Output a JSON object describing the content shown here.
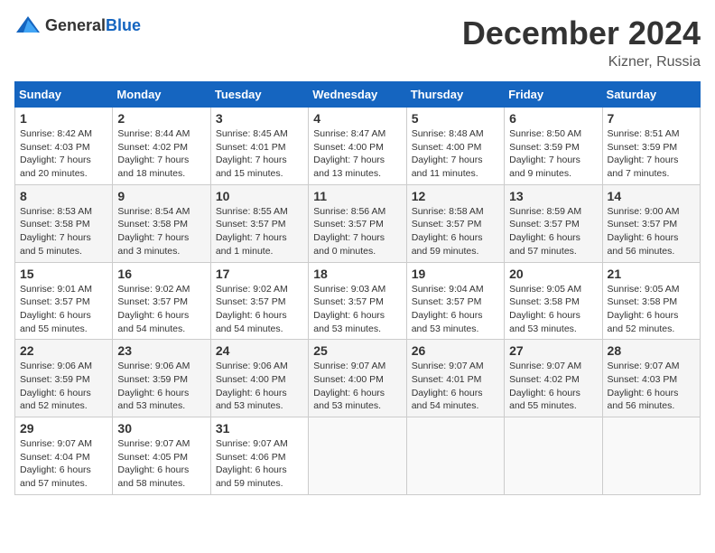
{
  "header": {
    "logo_general": "General",
    "logo_blue": "Blue",
    "title": "December 2024",
    "location": "Kizner, Russia"
  },
  "weekdays": [
    "Sunday",
    "Monday",
    "Tuesday",
    "Wednesday",
    "Thursday",
    "Friday",
    "Saturday"
  ],
  "weeks": [
    [
      {
        "day": "1",
        "info": "Sunrise: 8:42 AM\nSunset: 4:03 PM\nDaylight: 7 hours\nand 20 minutes."
      },
      {
        "day": "2",
        "info": "Sunrise: 8:44 AM\nSunset: 4:02 PM\nDaylight: 7 hours\nand 18 minutes."
      },
      {
        "day": "3",
        "info": "Sunrise: 8:45 AM\nSunset: 4:01 PM\nDaylight: 7 hours\nand 15 minutes."
      },
      {
        "day": "4",
        "info": "Sunrise: 8:47 AM\nSunset: 4:00 PM\nDaylight: 7 hours\nand 13 minutes."
      },
      {
        "day": "5",
        "info": "Sunrise: 8:48 AM\nSunset: 4:00 PM\nDaylight: 7 hours\nand 11 minutes."
      },
      {
        "day": "6",
        "info": "Sunrise: 8:50 AM\nSunset: 3:59 PM\nDaylight: 7 hours\nand 9 minutes."
      },
      {
        "day": "7",
        "info": "Sunrise: 8:51 AM\nSunset: 3:59 PM\nDaylight: 7 hours\nand 7 minutes."
      }
    ],
    [
      {
        "day": "8",
        "info": "Sunrise: 8:53 AM\nSunset: 3:58 PM\nDaylight: 7 hours\nand 5 minutes."
      },
      {
        "day": "9",
        "info": "Sunrise: 8:54 AM\nSunset: 3:58 PM\nDaylight: 7 hours\nand 3 minutes."
      },
      {
        "day": "10",
        "info": "Sunrise: 8:55 AM\nSunset: 3:57 PM\nDaylight: 7 hours\nand 1 minute."
      },
      {
        "day": "11",
        "info": "Sunrise: 8:56 AM\nSunset: 3:57 PM\nDaylight: 7 hours\nand 0 minutes."
      },
      {
        "day": "12",
        "info": "Sunrise: 8:58 AM\nSunset: 3:57 PM\nDaylight: 6 hours\nand 59 minutes."
      },
      {
        "day": "13",
        "info": "Sunrise: 8:59 AM\nSunset: 3:57 PM\nDaylight: 6 hours\nand 57 minutes."
      },
      {
        "day": "14",
        "info": "Sunrise: 9:00 AM\nSunset: 3:57 PM\nDaylight: 6 hours\nand 56 minutes."
      }
    ],
    [
      {
        "day": "15",
        "info": "Sunrise: 9:01 AM\nSunset: 3:57 PM\nDaylight: 6 hours\nand 55 minutes."
      },
      {
        "day": "16",
        "info": "Sunrise: 9:02 AM\nSunset: 3:57 PM\nDaylight: 6 hours\nand 54 minutes."
      },
      {
        "day": "17",
        "info": "Sunrise: 9:02 AM\nSunset: 3:57 PM\nDaylight: 6 hours\nand 54 minutes."
      },
      {
        "day": "18",
        "info": "Sunrise: 9:03 AM\nSunset: 3:57 PM\nDaylight: 6 hours\nand 53 minutes."
      },
      {
        "day": "19",
        "info": "Sunrise: 9:04 AM\nSunset: 3:57 PM\nDaylight: 6 hours\nand 53 minutes."
      },
      {
        "day": "20",
        "info": "Sunrise: 9:05 AM\nSunset: 3:58 PM\nDaylight: 6 hours\nand 53 minutes."
      },
      {
        "day": "21",
        "info": "Sunrise: 9:05 AM\nSunset: 3:58 PM\nDaylight: 6 hours\nand 52 minutes."
      }
    ],
    [
      {
        "day": "22",
        "info": "Sunrise: 9:06 AM\nSunset: 3:59 PM\nDaylight: 6 hours\nand 52 minutes."
      },
      {
        "day": "23",
        "info": "Sunrise: 9:06 AM\nSunset: 3:59 PM\nDaylight: 6 hours\nand 53 minutes."
      },
      {
        "day": "24",
        "info": "Sunrise: 9:06 AM\nSunset: 4:00 PM\nDaylight: 6 hours\nand 53 minutes."
      },
      {
        "day": "25",
        "info": "Sunrise: 9:07 AM\nSunset: 4:00 PM\nDaylight: 6 hours\nand 53 minutes."
      },
      {
        "day": "26",
        "info": "Sunrise: 9:07 AM\nSunset: 4:01 PM\nDaylight: 6 hours\nand 54 minutes."
      },
      {
        "day": "27",
        "info": "Sunrise: 9:07 AM\nSunset: 4:02 PM\nDaylight: 6 hours\nand 55 minutes."
      },
      {
        "day": "28",
        "info": "Sunrise: 9:07 AM\nSunset: 4:03 PM\nDaylight: 6 hours\nand 56 minutes."
      }
    ],
    [
      {
        "day": "29",
        "info": "Sunrise: 9:07 AM\nSunset: 4:04 PM\nDaylight: 6 hours\nand 57 minutes."
      },
      {
        "day": "30",
        "info": "Sunrise: 9:07 AM\nSunset: 4:05 PM\nDaylight: 6 hours\nand 58 minutes."
      },
      {
        "day": "31",
        "info": "Sunrise: 9:07 AM\nSunset: 4:06 PM\nDaylight: 6 hours\nand 59 minutes."
      },
      null,
      null,
      null,
      null
    ]
  ]
}
